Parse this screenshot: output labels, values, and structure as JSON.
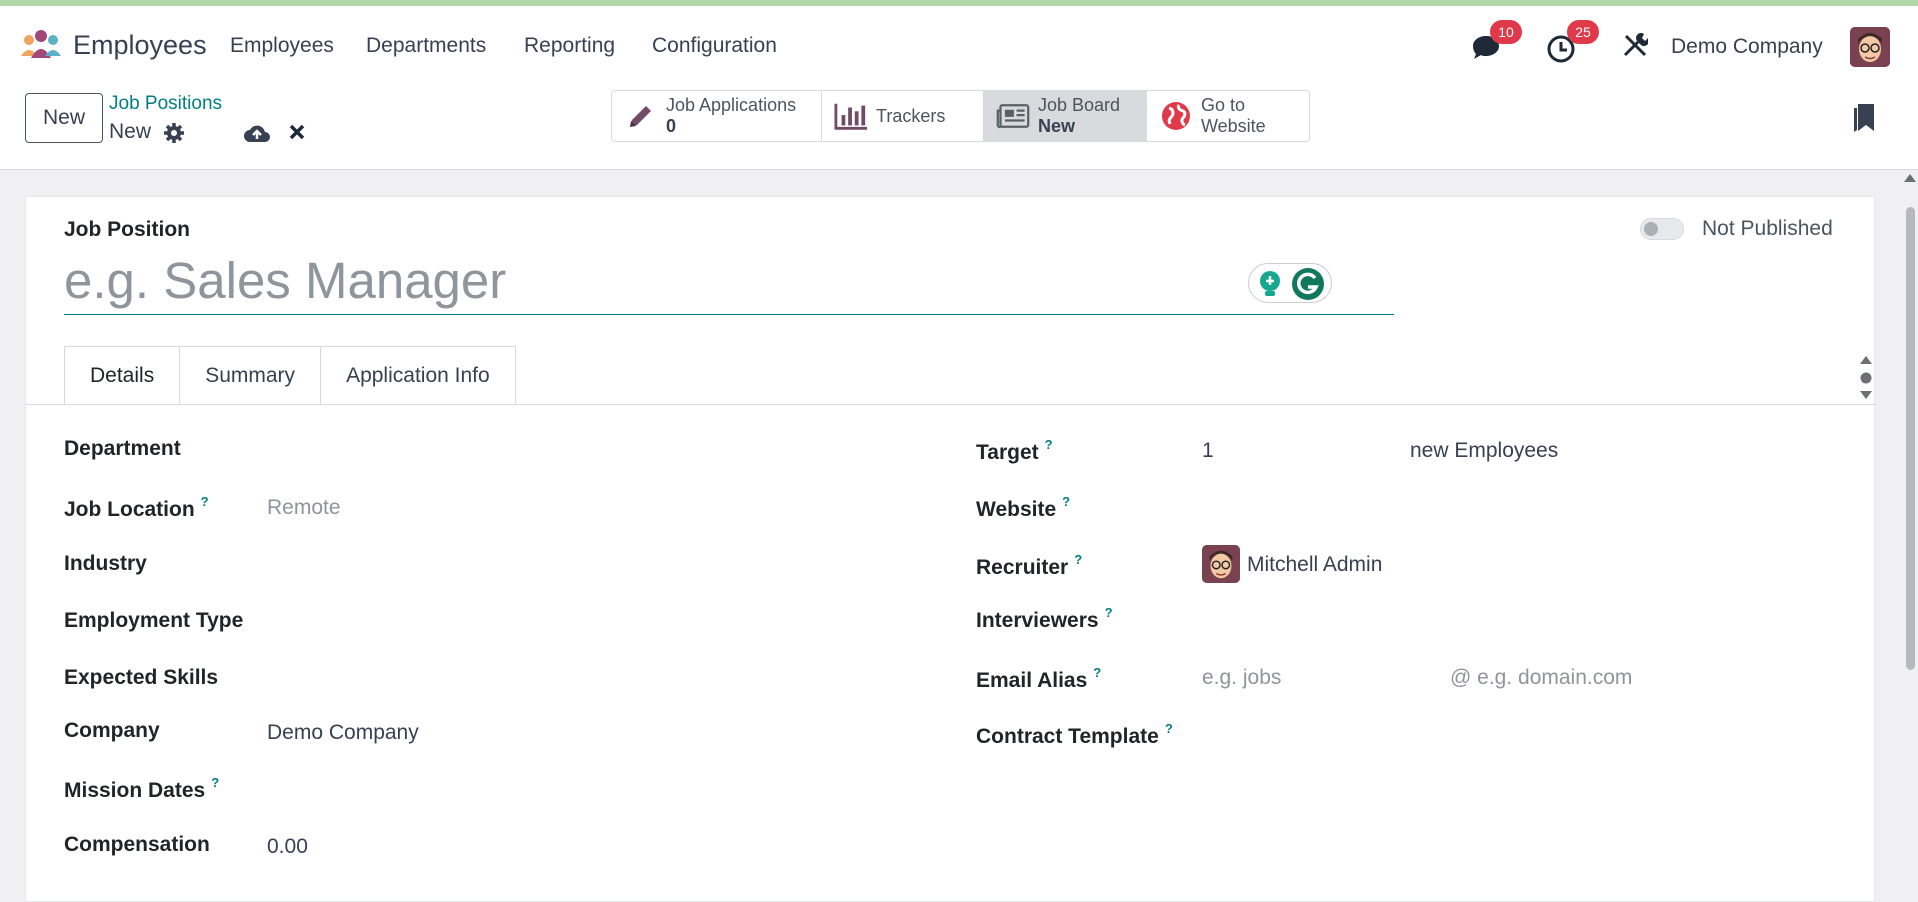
{
  "navbar": {
    "app_name": "Employees",
    "menus": [
      "Employees",
      "Departments",
      "Reporting",
      "Configuration"
    ],
    "messages_count": "10",
    "activities_count": "25",
    "company": "Demo Company"
  },
  "control": {
    "new_label": "New",
    "breadcrumb": "Job Positions",
    "record_name": "New",
    "smart_buttons": [
      {
        "label": "Job Applications",
        "value": "0",
        "icon": "pencil-icon"
      },
      {
        "label": "Trackers",
        "value": "",
        "icon": "bar-chart-icon"
      },
      {
        "label": "Job Board",
        "value": "New",
        "icon": "newspaper-icon"
      },
      {
        "label": "Go to",
        "value": "Website",
        "icon": "globe-icon"
      }
    ]
  },
  "form": {
    "job_position_label": "Job Position",
    "title_placeholder": "e.g. Sales Manager",
    "publish_label": "Not Published",
    "tabs": [
      "Details",
      "Summary",
      "Application Info"
    ],
    "left": {
      "department": "Department",
      "job_location": "Job Location",
      "job_location_value": "Remote",
      "industry": "Industry",
      "employment_type": "Employment Type",
      "expected_skills": "Expected Skills",
      "company": "Company",
      "company_value": "Demo Company",
      "mission_dates": "Mission Dates",
      "compensation": "Compensation",
      "compensation_value": "0.00"
    },
    "right": {
      "target": "Target",
      "target_value": "1",
      "target_suffix": "new Employees",
      "website": "Website",
      "recruiter": "Recruiter",
      "recruiter_value": "Mitchell Admin",
      "interviewers": "Interviewers",
      "email_alias": "Email Alias",
      "email_alias_placeholder": "e.g. jobs",
      "email_domain_placeholder": "@ e.g. domain.com",
      "contract_template": "Contract Template"
    },
    "help_mark": "?"
  },
  "colors": {
    "accent": "#017e84",
    "badge": "#e0394a",
    "brand": "#714b67"
  }
}
